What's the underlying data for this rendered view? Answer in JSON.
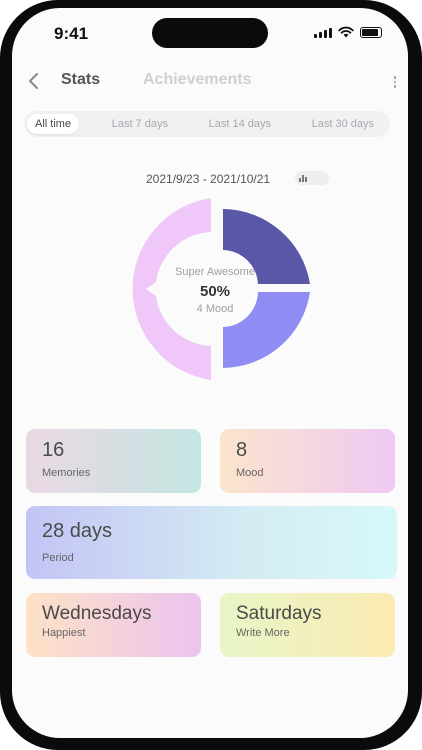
{
  "status_bar": {
    "time": "9:41"
  },
  "nav": {
    "tab_stats": "Stats",
    "tab_achievements": "Achievements"
  },
  "filters": {
    "items": [
      "All time",
      "Last 7 days",
      "Last 14 days",
      "Last 30 days"
    ],
    "active_index": 0
  },
  "date_range": "2021/9/23 - 2021/10/21",
  "mood_chart": {
    "center_label": "Super Awesome",
    "center_value": "50%",
    "center_sub": "4 Mood",
    "segments": [
      {
        "share": 0.5,
        "color": "#efc8f9"
      },
      {
        "share": 0.25,
        "color": "#5b57a8"
      },
      {
        "share": 0.25,
        "color": "#8f8cf4"
      }
    ]
  },
  "cards": {
    "memories": {
      "value": "16",
      "label": "Memories"
    },
    "mood": {
      "value": "8",
      "label": "Mood"
    },
    "period": {
      "value": "28 days",
      "label": "Period"
    },
    "happiest": {
      "value": "Wednesdays",
      "label": "Happiest"
    },
    "write_more": {
      "value": "Saturdays",
      "label": "Write More"
    }
  }
}
